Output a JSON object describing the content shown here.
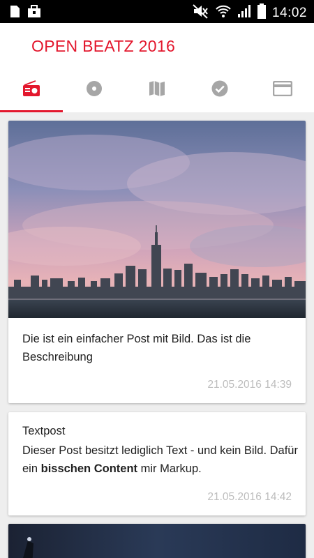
{
  "status_bar": {
    "time": "14:02",
    "left_icons": [
      "sim-card-icon",
      "briefcase-icon"
    ],
    "right_icons": [
      "mute-icon",
      "wifi-icon",
      "signal-icon",
      "battery-icon"
    ]
  },
  "app": {
    "title": "OPEN BEATZ 2016",
    "accent_color": "#e3172d"
  },
  "tabs": [
    {
      "icon": "radio-icon",
      "active": true
    },
    {
      "icon": "disc-icon",
      "active": false
    },
    {
      "icon": "map-icon",
      "active": false
    },
    {
      "icon": "check-circle-icon",
      "active": false
    },
    {
      "icon": "card-icon",
      "active": false
    }
  ],
  "posts": [
    {
      "image": "city-skyline-photo",
      "description": "Die ist ein einfacher Post mit Bild. Das ist die Beschreibung",
      "date": "21.05.2016 14:39"
    },
    {
      "title": "Textpost",
      "body_pre": "Dieser Post besitzt lediglich Text - und kein Bild. Dafür ein ",
      "body_bold": "bisschen Content",
      "body_post": " mir Markup.",
      "date": "21.05.2016 14:42"
    },
    {
      "image": "night-sky-photo"
    }
  ]
}
